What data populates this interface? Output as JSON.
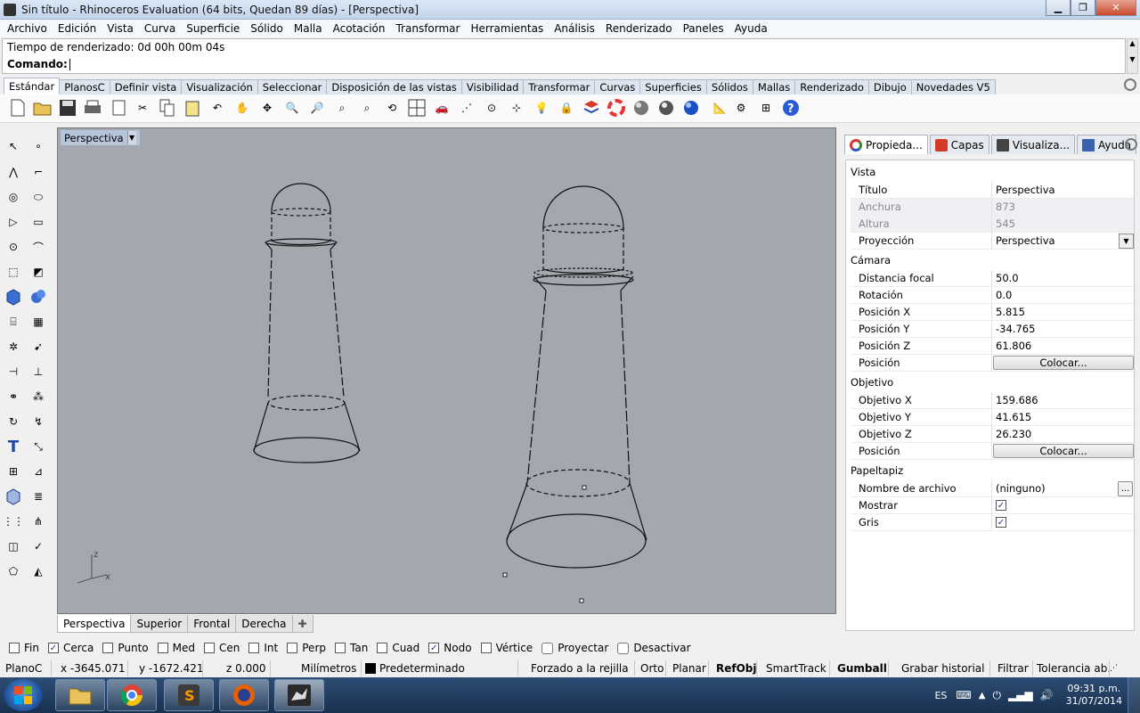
{
  "window": {
    "title": "Sin título - Rhinoceros Evaluation (64 bits, Quedan 89 días) - [Perspectiva]"
  },
  "menu": [
    "Archivo",
    "Edición",
    "Vista",
    "Curva",
    "Superficie",
    "Sólido",
    "Malla",
    "Acotación",
    "Transformar",
    "Herramientas",
    "Análisis",
    "Renderizado",
    "Paneles",
    "Ayuda"
  ],
  "command": {
    "history": "Tiempo de renderizado: 0d 00h 00m 04s",
    "prompt": "Comando:"
  },
  "toolbar_tabs": [
    "Estándar",
    "PlanosC",
    "Definir vista",
    "Visualización",
    "Seleccionar",
    "Disposición de las vistas",
    "Visibilidad",
    "Transformar",
    "Curvas",
    "Superficies",
    "Sólidos",
    "Mallas",
    "Renderizado",
    "Dibujo",
    "Novedades V5"
  ],
  "viewport": {
    "label": "Perspectiva",
    "tabs": [
      "Perspectiva",
      "Superior",
      "Frontal",
      "Derecha"
    ],
    "axes": {
      "z": "z",
      "x": "x"
    }
  },
  "panel": {
    "tabs": [
      "Propieda...",
      "Capas",
      "Visualiza...",
      "Ayuda"
    ],
    "sections": {
      "vista": "Vista",
      "camara": "Cámara",
      "objetivo": "Objetivo",
      "papeltapiz": "Papeltapiz"
    },
    "vista": {
      "titulo": {
        "k": "Título",
        "v": "Perspectiva"
      },
      "anchura": {
        "k": "Anchura",
        "v": "873"
      },
      "altura": {
        "k": "Altura",
        "v": "545"
      },
      "proyeccion": {
        "k": "Proyección",
        "v": "Perspectiva"
      }
    },
    "camara": {
      "focal": {
        "k": "Distancia focal",
        "v": "50.0"
      },
      "rotacion": {
        "k": "Rotación",
        "v": "0.0"
      },
      "px": {
        "k": "Posición X",
        "v": "5.815"
      },
      "py": {
        "k": "Posición Y",
        "v": "-34.765"
      },
      "pz": {
        "k": "Posición Z",
        "v": "61.806"
      },
      "pos": {
        "k": "Posición",
        "v": "Colocar..."
      }
    },
    "objetivo": {
      "ox": {
        "k": "Objetivo X",
        "v": "159.686"
      },
      "oy": {
        "k": "Objetivo Y",
        "v": "41.615"
      },
      "oz": {
        "k": "Objetivo Z",
        "v": "26.230"
      },
      "pos": {
        "k": "Posición",
        "v": "Colocar..."
      }
    },
    "papeltapiz": {
      "archivo": {
        "k": "Nombre de archivo",
        "v": "(ninguno)"
      },
      "mostrar": {
        "k": "Mostrar",
        "checked": true
      },
      "gris": {
        "k": "Gris",
        "checked": true
      }
    }
  },
  "osnaps": [
    {
      "label": "Fin",
      "checked": false
    },
    {
      "label": "Cerca",
      "checked": true
    },
    {
      "label": "Punto",
      "checked": false
    },
    {
      "label": "Med",
      "checked": false
    },
    {
      "label": "Cen",
      "checked": false
    },
    {
      "label": "Int",
      "checked": false
    },
    {
      "label": "Perp",
      "checked": false
    },
    {
      "label": "Tan",
      "checked": false
    },
    {
      "label": "Cuad",
      "checked": false
    },
    {
      "label": "Nodo",
      "checked": true
    },
    {
      "label": "Vértice",
      "checked": false
    }
  ],
  "osnap_extra": [
    "Proyectar",
    "Desactivar"
  ],
  "status": {
    "plane": "PlanoC",
    "x": "x -3645.071",
    "y": "y -1672.421",
    "z": "z 0.000",
    "units": "Milímetros",
    "layer": "Predeterminado",
    "grid": "Forzado a la rejilla",
    "orto": "Orto",
    "planar": "Planar",
    "refobj": "RefObj",
    "smarttrack": "SmartTrack",
    "gumball": "Gumball",
    "history": "Grabar historial",
    "filter": "Filtrar",
    "tolerance": "Tolerancia ab..."
  },
  "taskbar": {
    "lang": "ES",
    "time": "09:31 p.m.",
    "date": "31/07/2014"
  },
  "colors": {
    "viewport_bg": "#a3a7ae",
    "taskbar": "#1f3a5f"
  }
}
